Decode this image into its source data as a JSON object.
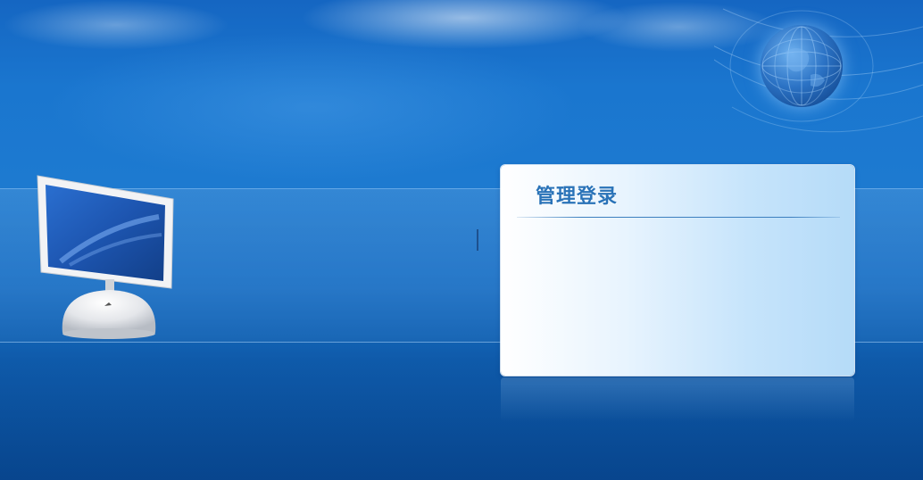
{
  "login": {
    "title": "管理登录"
  },
  "icons": {
    "globe": "globe-icon",
    "monitor": "monitor-icon"
  },
  "colors": {
    "background_top": "#1566c2",
    "background_bottom": "#0a4f98",
    "panel_title": "#2a73b8",
    "panel_divider": "#3c7fbf"
  }
}
